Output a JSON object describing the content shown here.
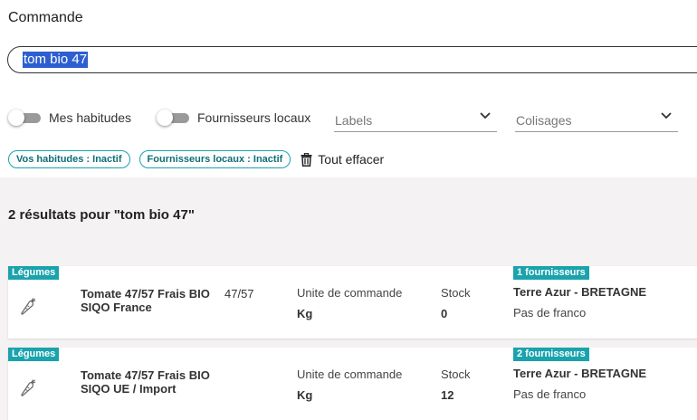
{
  "page": {
    "title": "Commande"
  },
  "search": {
    "value": "tom bio 47"
  },
  "filters": {
    "toggles": [
      {
        "label": "Mes habitudes",
        "on": false
      },
      {
        "label": "Fournisseurs locaux",
        "on": false
      }
    ],
    "selects": [
      {
        "placeholder": "Labels"
      },
      {
        "placeholder": "Colisages"
      }
    ]
  },
  "chips": [
    {
      "label": "Vos habitudes : Inactif"
    },
    {
      "label": "Fournisseurs locaux : Inactif"
    }
  ],
  "clear_all": {
    "label": "Tout effacer"
  },
  "results": {
    "summary": "2 résultats pour \"tom bio 47\"",
    "items": [
      {
        "category": "Légumes",
        "name": "Tomate 47/57 Frais BIO SIQO France",
        "caliber": "47/57",
        "unit_label": "Unite de commande",
        "unit_value": "Kg",
        "stock_label": "Stock",
        "stock_value": "0",
        "supplier_count": "1 fournisseurs",
        "supplier_name": "Terre Azur - BRETAGNE",
        "franco": "Pas de franco"
      },
      {
        "category": "Légumes",
        "name": "Tomate 47/57 Frais BIO SIQO UE / Import",
        "caliber": "",
        "unit_label": "Unite de commande",
        "unit_value": "Kg",
        "stock_label": "Stock",
        "stock_value": "12",
        "supplier_count": "2 fournisseurs",
        "supplier_name": "Terre Azur - BRETAGNE",
        "franco": "Pas de franco"
      }
    ]
  },
  "icons": {
    "product": "carrot-icon",
    "clear": "trash-icon",
    "select": "chevron-down-icon"
  },
  "colors": {
    "accent": "#1aa3ad",
    "selection": "#2d5fd0",
    "results_bg": "#f4f2f2"
  }
}
